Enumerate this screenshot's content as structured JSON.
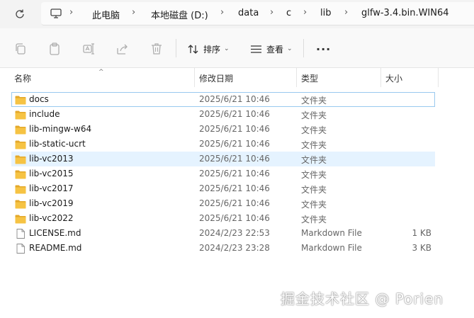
{
  "address": {
    "breadcrumbs": [
      "此电脑",
      "本地磁盘 (D:)",
      "data",
      "c",
      "lib",
      "glfw-3.4.bin.WIN64"
    ]
  },
  "toolbar": {
    "sort_label": "排序",
    "view_label": "查看"
  },
  "columns": {
    "name": "名称",
    "date": "修改日期",
    "type": "类型",
    "size": "大小"
  },
  "files": [
    {
      "name": "docs",
      "date": "2025/6/21 10:46",
      "type": "文件夹",
      "size": "",
      "kind": "folder"
    },
    {
      "name": "include",
      "date": "2025/6/21 10:46",
      "type": "文件夹",
      "size": "",
      "kind": "folder"
    },
    {
      "name": "lib-mingw-w64",
      "date": "2025/6/21 10:46",
      "type": "文件夹",
      "size": "",
      "kind": "folder"
    },
    {
      "name": "lib-static-ucrt",
      "date": "2025/6/21 10:46",
      "type": "文件夹",
      "size": "",
      "kind": "folder"
    },
    {
      "name": "lib-vc2013",
      "date": "2025/6/21 10:46",
      "type": "文件夹",
      "size": "",
      "kind": "folder"
    },
    {
      "name": "lib-vc2015",
      "date": "2025/6/21 10:46",
      "type": "文件夹",
      "size": "",
      "kind": "folder"
    },
    {
      "name": "lib-vc2017",
      "date": "2025/6/21 10:46",
      "type": "文件夹",
      "size": "",
      "kind": "folder"
    },
    {
      "name": "lib-vc2019",
      "date": "2025/6/21 10:46",
      "type": "文件夹",
      "size": "",
      "kind": "folder"
    },
    {
      "name": "lib-vc2022",
      "date": "2025/6/21 10:46",
      "type": "文件夹",
      "size": "",
      "kind": "folder"
    },
    {
      "name": "LICENSE.md",
      "date": "2024/2/23 22:53",
      "type": "Markdown File",
      "size": "1 KB",
      "kind": "file"
    },
    {
      "name": "README.md",
      "date": "2024/2/23 23:28",
      "type": "Markdown File",
      "size": "3 KB",
      "kind": "file"
    }
  ],
  "watermark": "掘金技术社区 @ Porien",
  "colors": {
    "folder": "#f6c343",
    "folder_dark": "#e4a82a",
    "hover_row": "#e5f3ff",
    "focus_border": "#99c9ef"
  }
}
